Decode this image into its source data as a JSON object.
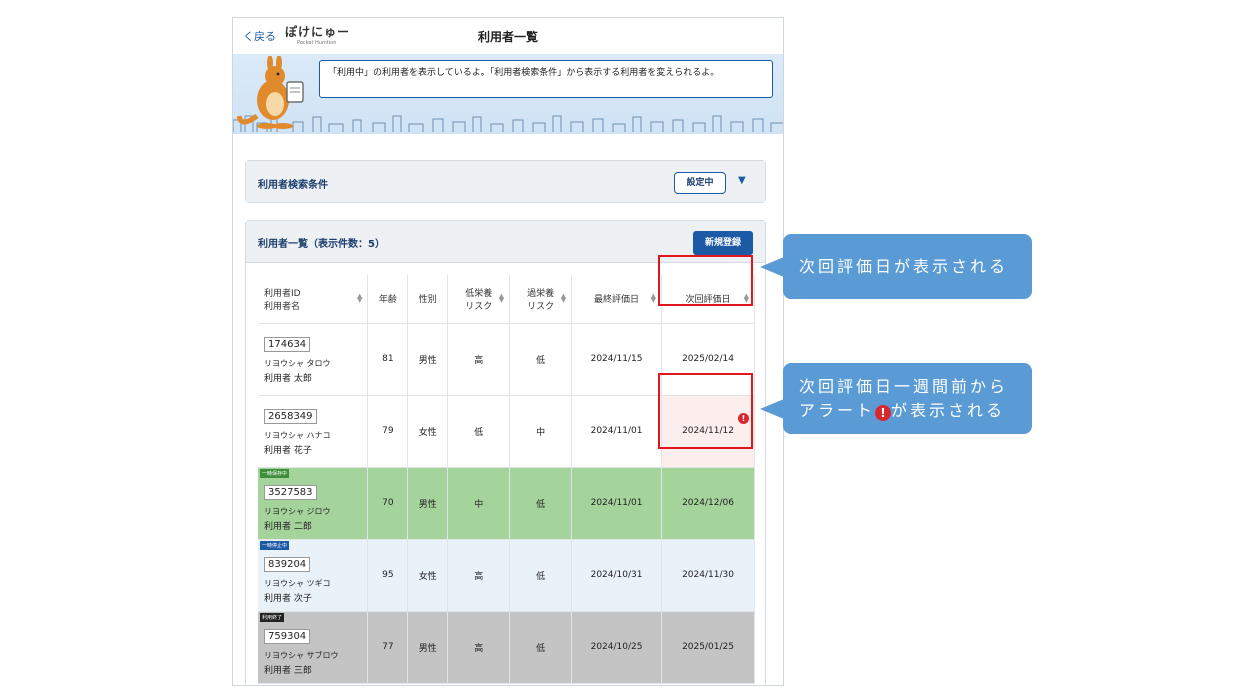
{
  "header": {
    "back_label": "く戻る",
    "logo_text": "ぽけにゅー",
    "logo_sub": "Pocket Humtion",
    "page_title": "利用者一覧"
  },
  "banner": {
    "message": "「利用中」の利用者を表示しているよ。「利用者検索条件」から表示する利用者を変えられるよ。"
  },
  "search": {
    "title": "利用者検索条件",
    "setting_label": "設定中",
    "caret": "▼"
  },
  "list": {
    "title": "利用者一覧（表示件数：5）",
    "new_label": "新規登録",
    "columns": [
      {
        "l1": "利用者ID",
        "l2": "利用者名"
      },
      {
        "l1": "年齢",
        "l2": ""
      },
      {
        "l1": "性別",
        "l2": ""
      },
      {
        "l1": "低栄養",
        "l2": "リスク"
      },
      {
        "l1": "過栄養",
        "l2": "リスク"
      },
      {
        "l1": "最終評価日",
        "l2": ""
      },
      {
        "l1": "次回評価日",
        "l2": ""
      }
    ],
    "rows": [
      {
        "id": "174634",
        "kana": "リヨウシャ タロウ",
        "name": "利用者 太郎",
        "age": "81",
        "sex": "男性",
        "low": "高",
        "over": "低",
        "last": "2024/11/15",
        "next": "2025/02/14",
        "tag": ""
      },
      {
        "id": "2658349",
        "kana": "リヨウシャ ハナコ",
        "name": "利用者 花子",
        "age": "79",
        "sex": "女性",
        "low": "低",
        "over": "中",
        "last": "2024/11/01",
        "next": "2024/11/12",
        "tag": ""
      },
      {
        "id": "3527583",
        "kana": "リヨウシャ ジロウ",
        "name": "利用者 二郎",
        "age": "70",
        "sex": "男性",
        "low": "中",
        "over": "低",
        "last": "2024/11/01",
        "next": "2024/12/06",
        "tag": "一時保存中"
      },
      {
        "id": "839204",
        "kana": "リヨウシャ ツギコ",
        "name": "利用者 次子",
        "age": "95",
        "sex": "女性",
        "low": "高",
        "over": "低",
        "last": "2024/10/31",
        "next": "2024/11/30",
        "tag": "一時停止中"
      },
      {
        "id": "759304",
        "kana": "リヨウシャ サブロウ",
        "name": "利用者 三郎",
        "age": "77",
        "sex": "男性",
        "low": "高",
        "over": "低",
        "last": "2024/10/25",
        "next": "2025/01/25",
        "tag": "利用終了"
      }
    ]
  },
  "callouts": {
    "c1": "次回評価日が表示される",
    "c2_line1": "次回評価日一週間前から",
    "c2_prefix": "アラート",
    "c2_suffix": "が表示される"
  },
  "icons": {
    "alert": "!",
    "sort": "⇕"
  },
  "colors": {
    "accent": "#1c5aa6",
    "callout": "#5b9bd5",
    "highlight": "#e0161c",
    "alert": "#d9272e",
    "green_row": "#a5d39c",
    "blue_row": "#e9f1f9",
    "gray_row": "#c4c4c4"
  }
}
